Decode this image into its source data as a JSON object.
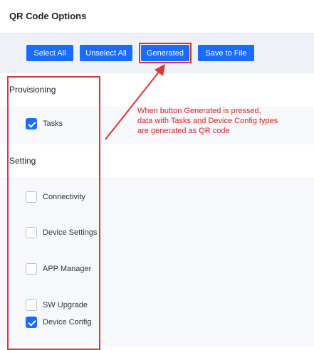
{
  "page": {
    "title": "QR Code Options"
  },
  "toolbar": {
    "select_all": "Select All",
    "unselect_all": "Unselect All",
    "generated": "Generated",
    "save_to_file": "Save to File"
  },
  "sections": {
    "provisioning": {
      "label": "Provisioning",
      "items": [
        {
          "label": "Tasks",
          "checked": true
        }
      ]
    },
    "setting": {
      "label": "Setting",
      "items": [
        {
          "label": "Connectivity",
          "checked": false
        },
        {
          "label": "Device Settings",
          "checked": false
        },
        {
          "label": "APP Manager",
          "checked": false
        },
        {
          "label": "SW Upgrade",
          "checked": false
        },
        {
          "label": "Device Config",
          "checked": true
        }
      ]
    }
  },
  "annotation": {
    "lines": [
      "When button Generated is pressed,",
      "data with Tasks and Device Config types",
      "are generated as QR code"
    ]
  },
  "colors": {
    "primary": "#1a6bff",
    "highlight": "#e03333",
    "panel": "#eef2f8"
  }
}
